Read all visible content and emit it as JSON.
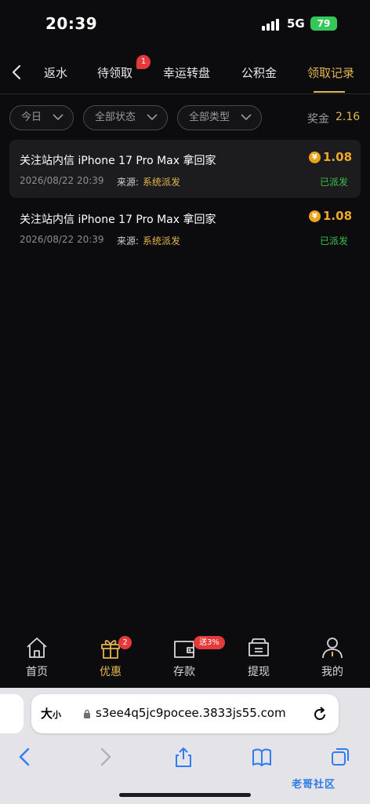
{
  "status_bar": {
    "time": "20:39",
    "network": "5G",
    "battery": "79"
  },
  "tabs": {
    "items": [
      {
        "label": "返水"
      },
      {
        "label": "待领取",
        "badge": "1"
      },
      {
        "label": "幸运转盘"
      },
      {
        "label": "公积金"
      },
      {
        "label": "领取记录",
        "active": true
      }
    ]
  },
  "filters": {
    "date": "今日",
    "status": "全部状态",
    "type": "全部类型"
  },
  "bonus": {
    "label": "奖金",
    "value": "2.16"
  },
  "records": [
    {
      "title": "关注站内信 iPhone 17 Pro Max 拿回家",
      "date": "2026/08/22 20:39",
      "source_label": "来源:",
      "source": "系统派发",
      "amount": "1.08",
      "status": "已派发",
      "highlighted": true
    },
    {
      "title": "关注站内信 iPhone 17 Pro Max 拿回家",
      "date": "2026/08/22 20:39",
      "source_label": "来源:",
      "source": "系统派发",
      "amount": "1.08",
      "status": "已派发",
      "highlighted": false
    }
  ],
  "bottom_nav": [
    {
      "label": "首页",
      "icon": "home-icon"
    },
    {
      "label": "优惠",
      "icon": "gift-icon",
      "badge": "2",
      "active": true
    },
    {
      "label": "存款",
      "icon": "wallet-icon",
      "badge": "送3%"
    },
    {
      "label": "提现",
      "icon": "withdraw-icon"
    },
    {
      "label": "我的",
      "icon": "person-icon"
    }
  ],
  "browser": {
    "text_size_label": "大",
    "text_size_small": "小",
    "url": "s3ee4q5jc9pocee.3833js55.com",
    "watermark": "老哥社区"
  },
  "colors": {
    "accent": "#e3b552",
    "background": "#0c0c0e",
    "success": "#36c24a",
    "badge": "#e5393b",
    "amount": "#f0a82a"
  }
}
